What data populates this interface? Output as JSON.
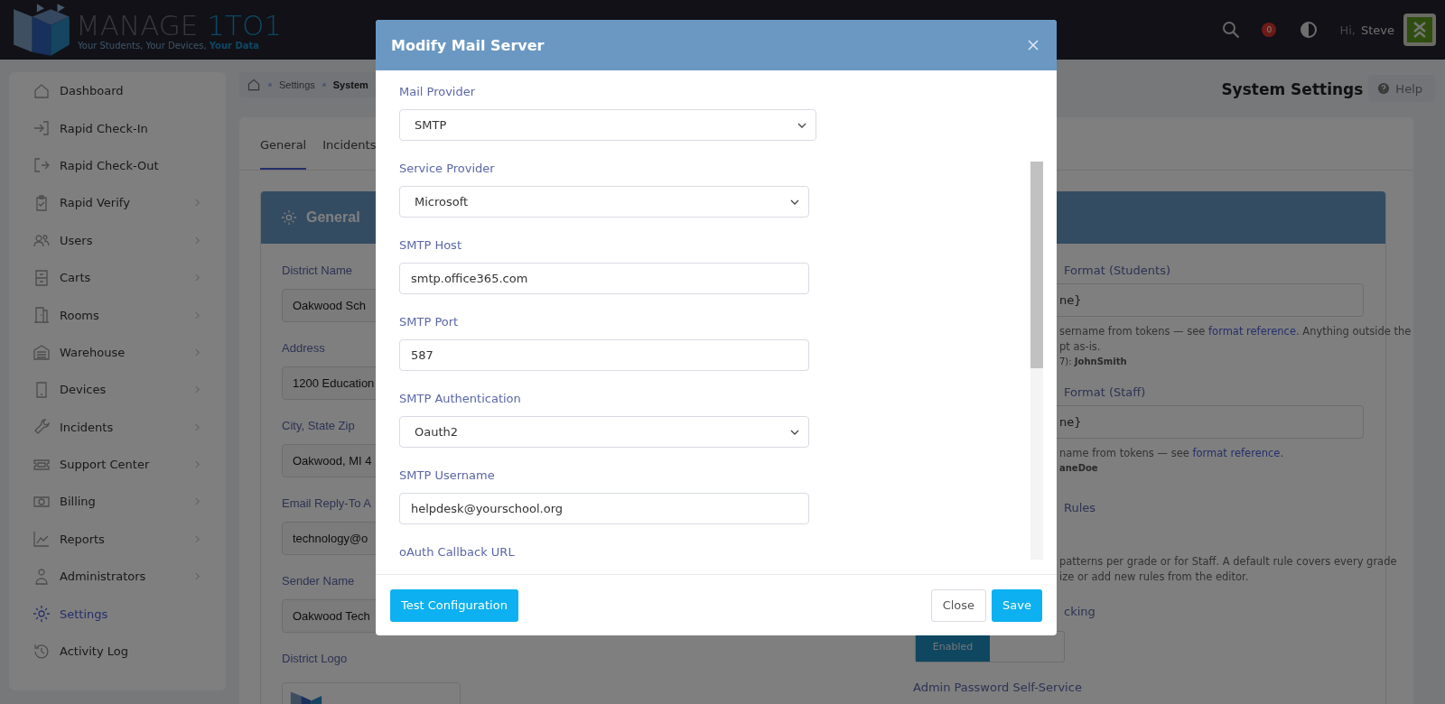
{
  "header": {
    "logo_word": "MANAGE",
    "logo_accent": "1TO1",
    "tagline": "Your Students, Your Devices,",
    "tagline_accent": "Your Data",
    "notification_count": "0",
    "greeting": "Hi,",
    "user_name": "Steve"
  },
  "sidebar": {
    "items": [
      {
        "label": "Dashboard",
        "selected": false,
        "submenu": false
      },
      {
        "label": "Rapid Check-In",
        "selected": false,
        "submenu": false
      },
      {
        "label": "Rapid Check-Out",
        "selected": false,
        "submenu": false
      },
      {
        "label": "Rapid Verify",
        "selected": false,
        "submenu": true
      },
      {
        "label": "Users",
        "selected": false,
        "submenu": true
      },
      {
        "label": "Carts",
        "selected": false,
        "submenu": true
      },
      {
        "label": "Rooms",
        "selected": false,
        "submenu": true
      },
      {
        "label": "Warehouse",
        "selected": false,
        "submenu": true
      },
      {
        "label": "Devices",
        "selected": false,
        "submenu": true
      },
      {
        "label": "Incidents",
        "selected": false,
        "submenu": true
      },
      {
        "label": "Support Center",
        "selected": false,
        "submenu": true
      },
      {
        "label": "Billing",
        "selected": false,
        "submenu": true
      },
      {
        "label": "Reports",
        "selected": false,
        "submenu": true
      },
      {
        "label": "Administrators",
        "selected": false,
        "submenu": true
      },
      {
        "label": "Settings",
        "selected": true,
        "submenu": false
      },
      {
        "label": "Activity Log",
        "selected": false,
        "submenu": false
      }
    ]
  },
  "breadcrumb": [
    "Settings",
    "System"
  ],
  "page_title": "System Settings",
  "help_button": "Help",
  "tabs": [
    {
      "label": "General",
      "selected": true
    },
    {
      "label": "Incidents",
      "selected": false
    }
  ],
  "section_title": "General",
  "left_fields": [
    {
      "label": "District Name",
      "value": "Oakwood Sch"
    },
    {
      "label": "Address",
      "value": "1200 Education"
    },
    {
      "label": "City, State Zip",
      "value": "Oakwood, MI 4"
    },
    {
      "label": "Email Reply-To A",
      "value": "technology@o"
    },
    {
      "label": "Sender Name",
      "value": "Oakwood Tech"
    }
  ],
  "district_logo": {
    "label": "District Logo"
  },
  "right_blocks": [
    {
      "kind": "label",
      "text": "Format (Students)"
    },
    {
      "kind": "input",
      "text": "ne}"
    },
    {
      "kind": "help",
      "text": "sername from tokens — see ",
      "link": "format reference",
      "after": ". Anything outside the"
    },
    {
      "kind": "help",
      "text": "pt as-is."
    },
    {
      "kind": "example",
      "text": "7): **JohnSmith**"
    },
    {
      "kind": "label",
      "text": "Format (Staff)"
    },
    {
      "kind": "input",
      "text": "ne}"
    },
    {
      "kind": "help",
      "text": "name from tokens — see ",
      "link": "format reference",
      "after": "."
    },
    {
      "kind": "example",
      "text": "**aneDoe**"
    },
    {
      "kind": "label",
      "text": "Rules"
    },
    {
      "kind": "help",
      "text": "patterns per grade or for Staff. A default rule covers every grade"
    },
    {
      "kind": "help",
      "text": "ize or add new rules from the editor."
    },
    {
      "kind": "label",
      "text": "cking"
    },
    {
      "kind": "toggle",
      "text": "Enabled",
      "on": true
    },
    {
      "kind": "label",
      "text": "Admin Password Self-Service"
    }
  ],
  "modal": {
    "title": "Modify Mail Server",
    "fields": [
      {
        "kind": "select",
        "label": "Mail Provider",
        "value": "SMTP"
      },
      {
        "kind": "select",
        "label": "Service Provider",
        "value": "Microsoft"
      },
      {
        "kind": "input",
        "label": "SMTP Host",
        "value": "smtp.office365.com"
      },
      {
        "kind": "input",
        "label": "SMTP Port",
        "value": "587"
      },
      {
        "kind": "select",
        "label": "SMTP Authentication",
        "value": "Oauth2"
      },
      {
        "kind": "input",
        "label": "SMTP Username",
        "value": "helpdesk@yourschool.org"
      },
      {
        "kind": "label",
        "label": "oAuth Callback URL"
      }
    ],
    "test_button": "Test Configuration",
    "close_button": "Close",
    "save_button": "Save"
  }
}
